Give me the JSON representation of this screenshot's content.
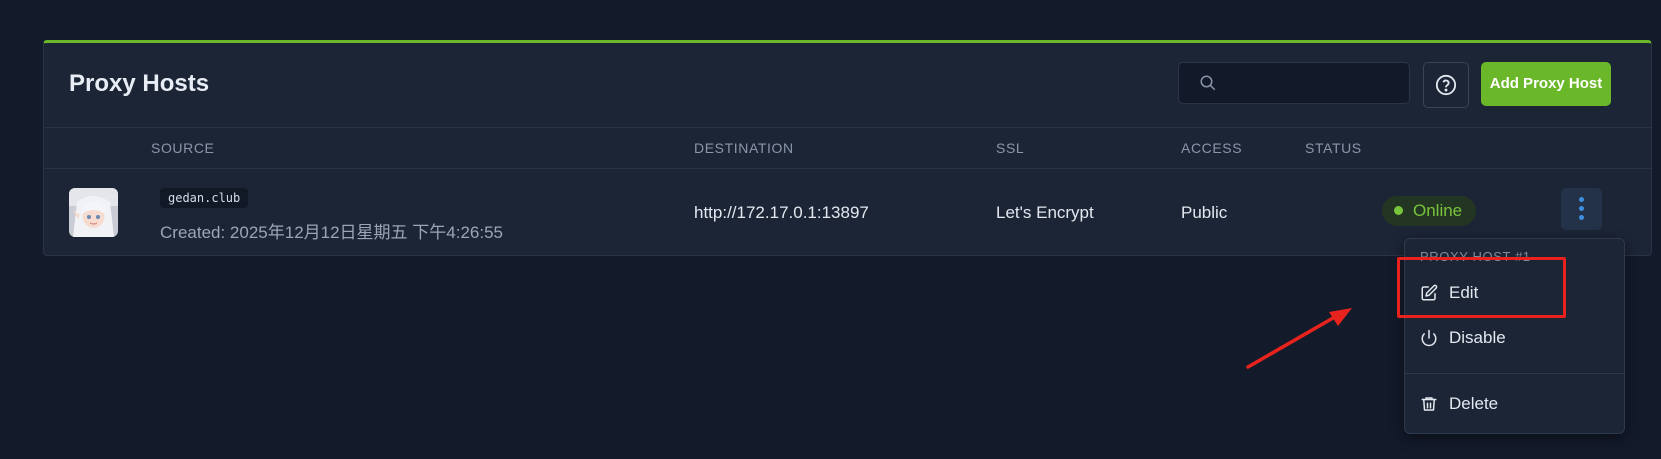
{
  "header": {
    "title": "Proxy Hosts",
    "search_placeholder": "",
    "add_button_label": "Add Proxy Host",
    "help_icon": "help-circle-icon",
    "accent_color": "#6ab82a"
  },
  "table": {
    "columns": [
      "SOURCE",
      "DESTINATION",
      "SSL",
      "ACCESS",
      "STATUS"
    ],
    "rows": [
      {
        "domain": "gedan.club",
        "created": "Created: 2025年12月12日星期五 下午4:26:55",
        "destination": "http://172.17.0.1:13897",
        "ssl": "Let's Encrypt",
        "access": "Public",
        "status": "Online",
        "status_color": "#78c43a"
      }
    ]
  },
  "menu": {
    "header": "PROXY HOST #1",
    "items": [
      {
        "label": "Edit",
        "icon": "edit-icon"
      },
      {
        "label": "Disable",
        "icon": "power-icon"
      },
      {
        "label": "Delete",
        "icon": "trash-icon"
      }
    ]
  },
  "annotation": {
    "highlight_color": "#e8231d"
  }
}
